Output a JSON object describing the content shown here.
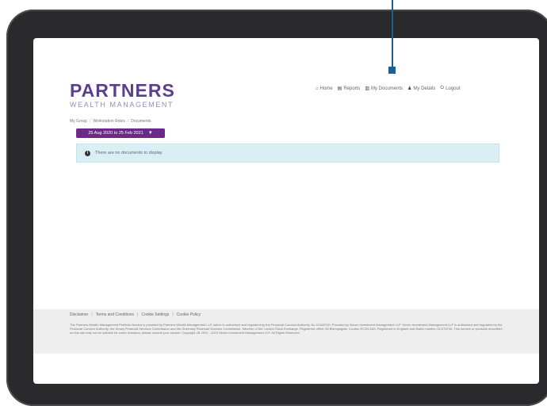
{
  "logo": {
    "main": "PARTNERS",
    "sub": "WEALTH MANAGEMENT"
  },
  "nav": [
    {
      "icon": "home-icon",
      "glyph": "⌂",
      "label": "Home"
    },
    {
      "icon": "reports-icon",
      "glyph": "▤",
      "label": "Reports"
    },
    {
      "icon": "documents-icon",
      "glyph": "▥",
      "label": "My Documents"
    },
    {
      "icon": "user-icon",
      "glyph": "♟",
      "label": "My Details"
    },
    {
      "icon": "power-icon",
      "glyph": "⏻",
      "label": "Logout"
    }
  ],
  "breadcrumb": [
    "My Group",
    "Workstation Roles",
    "Documents"
  ],
  "date_range": "25 Aug 2020 to 25 Feb 2021",
  "alert": {
    "text": "There are no documents to display"
  },
  "footer": {
    "links": [
      "Disclaimer",
      "Terms and Conditions",
      "Cookie Settings",
      "Cookie Policy"
    ],
    "text": "The Partners Wealth Management Portfolio Service is provided by Partners Wealth Management LLP, which is authorised and regulated by the Financial Conduct Authority, No 01345700. Provided by Seven Investment Management LLP. Seven Investment Management LLP is authorised and regulated by the Financial Conduct Authority, the Jersey Financial Services Commission and the Guernsey Financial Services Commission. Member of the London Stock Exchange. Registered office: 55 Bishopsgate, London EC2N 3AS. Registered in England and Wales number OC378740. This service or products described on this site may not be suitable for some investors; please consult your adviser. Copyright 2B 2001 - 2019 Seven Investment Management LLP. All Rights Reserved."
  },
  "colors": {
    "brand": "#5b3f8f",
    "button": "#6a2a86",
    "alert_bg": "#d9eef5",
    "marker": "#1f5f8e"
  }
}
